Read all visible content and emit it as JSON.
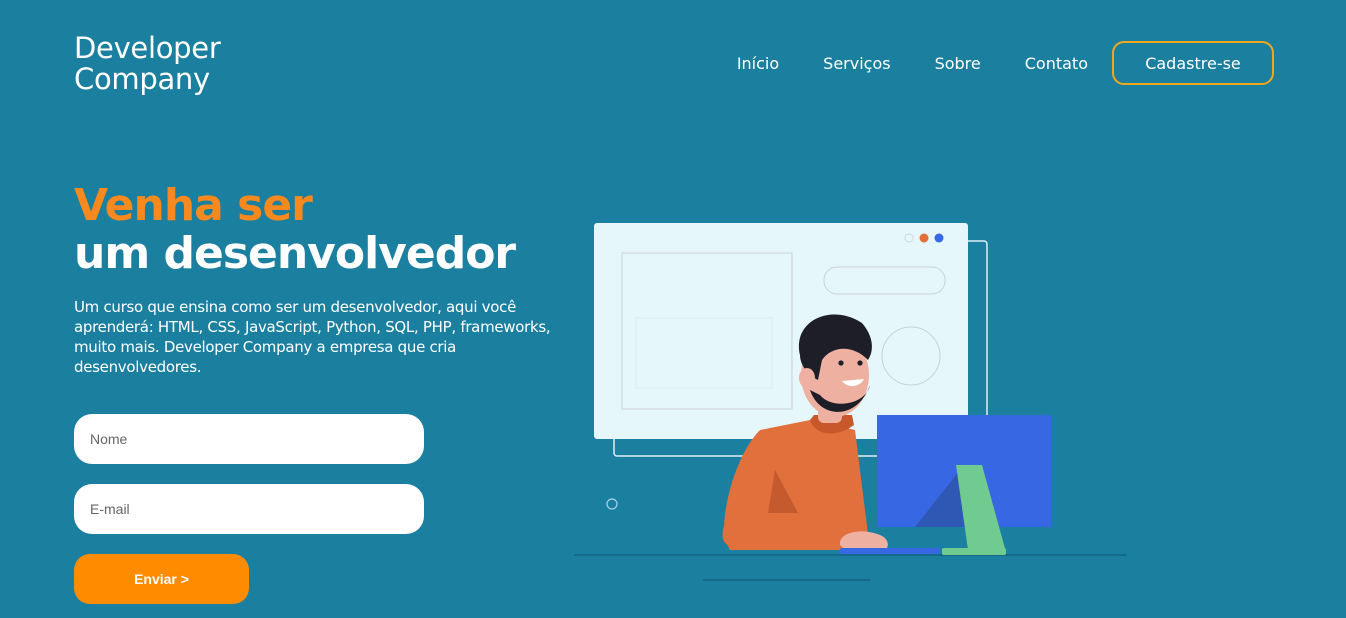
{
  "brand": {
    "line1": "Developer",
    "line2": "Company"
  },
  "nav": {
    "items": [
      {
        "label": "Início"
      },
      {
        "label": "Serviços"
      },
      {
        "label": "Sobre"
      },
      {
        "label": "Contato"
      }
    ],
    "cta_label": "Cadastre-se"
  },
  "hero": {
    "title_line1": "Venha ser",
    "title_line2": "um desenvolvedor",
    "description": "Um curso que ensina como ser um desenvolvedor, aqui você aprenderá: HTML, CSS, JavaScript, Python, SQL, PHP, frameworks, muito mais. Developer Company a empresa que cria desenvolvedores."
  },
  "form": {
    "name_placeholder": "Nome",
    "email_placeholder": "E-mail",
    "submit_label": "Enviar >"
  },
  "colors": {
    "background": "#1b7fa0",
    "accent_orange": "#f7891e",
    "button_orange": "#ff8c00",
    "cta_border": "#f0a81c"
  }
}
